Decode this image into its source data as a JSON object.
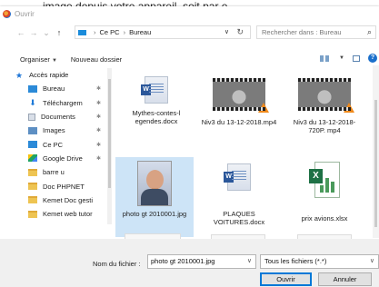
{
  "background_caption": "image depuis votre appareil, soit par e",
  "window": {
    "title": "Ouvrir"
  },
  "navigation": {
    "back_glyph": "←",
    "forward_glyph": "→",
    "recent_glyph": "⌄",
    "up_glyph": "↑",
    "breadcrumb": [
      "Ce PC",
      "Bureau"
    ],
    "separator": "›",
    "search_placeholder": "Rechercher dans : Bureau"
  },
  "toolbar": {
    "organize_label": "Organiser",
    "new_folder_label": "Nouveau dossier",
    "help_label": "?"
  },
  "sidebar": {
    "items": [
      {
        "label": "Accès rapide",
        "icon": "star-icon",
        "level": "top"
      },
      {
        "label": "Bureau",
        "icon": "desktop-icon",
        "pinned": true
      },
      {
        "label": "Téléchargem",
        "icon": "download-icon",
        "pinned": true
      },
      {
        "label": "Documents",
        "icon": "documents-icon",
        "pinned": true
      },
      {
        "label": "Images",
        "icon": "images-icon",
        "pinned": true
      },
      {
        "label": "Ce PC",
        "icon": "computer-icon",
        "pinned": true
      },
      {
        "label": "Google Drive",
        "icon": "google-drive-icon",
        "pinned": true
      },
      {
        "label": "barre u",
        "icon": "folder-icon",
        "pinned": false
      },
      {
        "label": "Doc PHPNET",
        "icon": "folder-icon",
        "pinned": false
      },
      {
        "label": "Kemet Doc gesti",
        "icon": "folder-icon",
        "pinned": false
      },
      {
        "label": "Kemet web tutor",
        "icon": "folder-icon",
        "pinned": false
      }
    ],
    "pin_glyph": "✱"
  },
  "files": [
    {
      "name": "Mythes-contes-l egendes.docx",
      "type": "docx"
    },
    {
      "name": "Niv3 du 13-12-2018.mp4",
      "type": "mp4"
    },
    {
      "name": "Niv3 du 13-12-2018-720P. mp4",
      "type": "mp4"
    },
    {
      "name": "photo gt 2010001.jpg",
      "type": "jpg",
      "selected": true
    },
    {
      "name": "PLAQUES VOITURES.docx",
      "type": "docx"
    },
    {
      "name": "prix avions.xlsx",
      "type": "xlsx"
    }
  ],
  "footer": {
    "filename_label": "Nom du fichier :",
    "filename_value": "photo gt 2010001.jpg",
    "filter_value": "Tous les fichiers (*.*)",
    "open_label": "Ouvrir",
    "cancel_label": "Annuler"
  },
  "colors": {
    "accent": "#0078d7",
    "selection": "#cde4f7"
  }
}
